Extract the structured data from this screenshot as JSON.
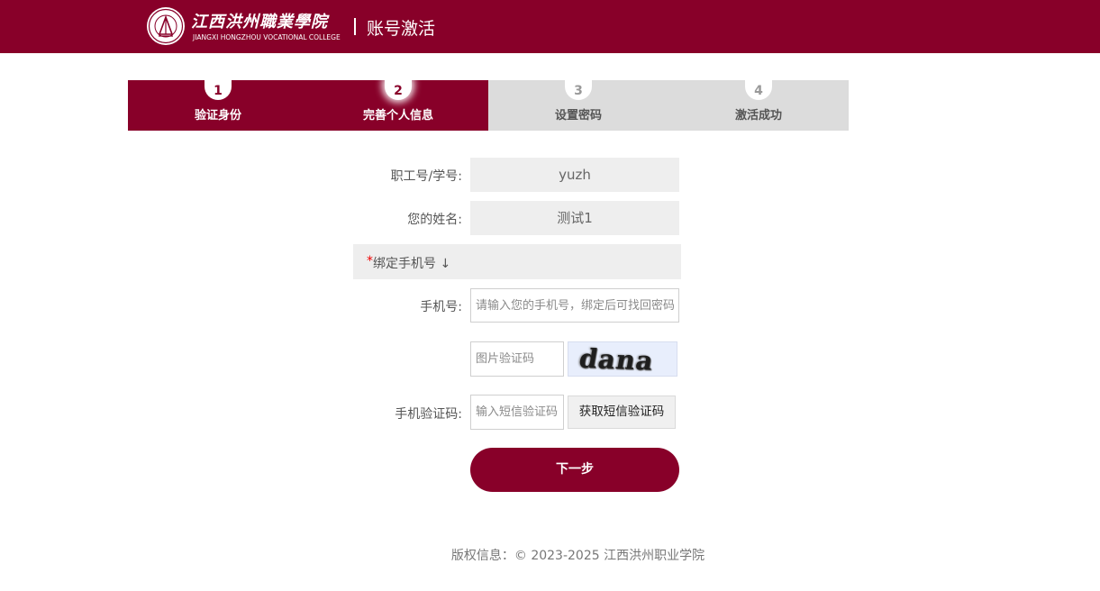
{
  "header": {
    "logo_cn": "江西洪州職業學院",
    "logo_en": "JIANGXI HONGZHOU VOCATIONAL COLLEGE",
    "page_title": "账号激活",
    "bg_color": "#880029"
  },
  "steps": [
    {
      "num": "1",
      "label": "验证身份",
      "state": "done"
    },
    {
      "num": "2",
      "label": "完善个人信息",
      "state": "current"
    },
    {
      "num": "3",
      "label": "设置密码",
      "state": "todo"
    },
    {
      "num": "4",
      "label": "激活成功",
      "state": "todo"
    }
  ],
  "form": {
    "staff_id_label": "职工号/学号:",
    "staff_id_value": "yuzh",
    "name_label": "您的姓名:",
    "name_value": "测试1",
    "bind_section_star": "*",
    "bind_section_label": "绑定手机号 ↓",
    "phone_label": "手机号:",
    "phone_placeholder": "请输入您的手机号，绑定后可找回密码",
    "captcha_placeholder": "图片验证码",
    "captcha_text": "dana",
    "sms_label": "手机验证码:",
    "sms_placeholder": "输入短信验证码",
    "sms_button": "获取短信验证码",
    "next_button": "下一步"
  },
  "footer": {
    "text": "版权信息：© 2023-2025 江西洪州职业学院"
  }
}
